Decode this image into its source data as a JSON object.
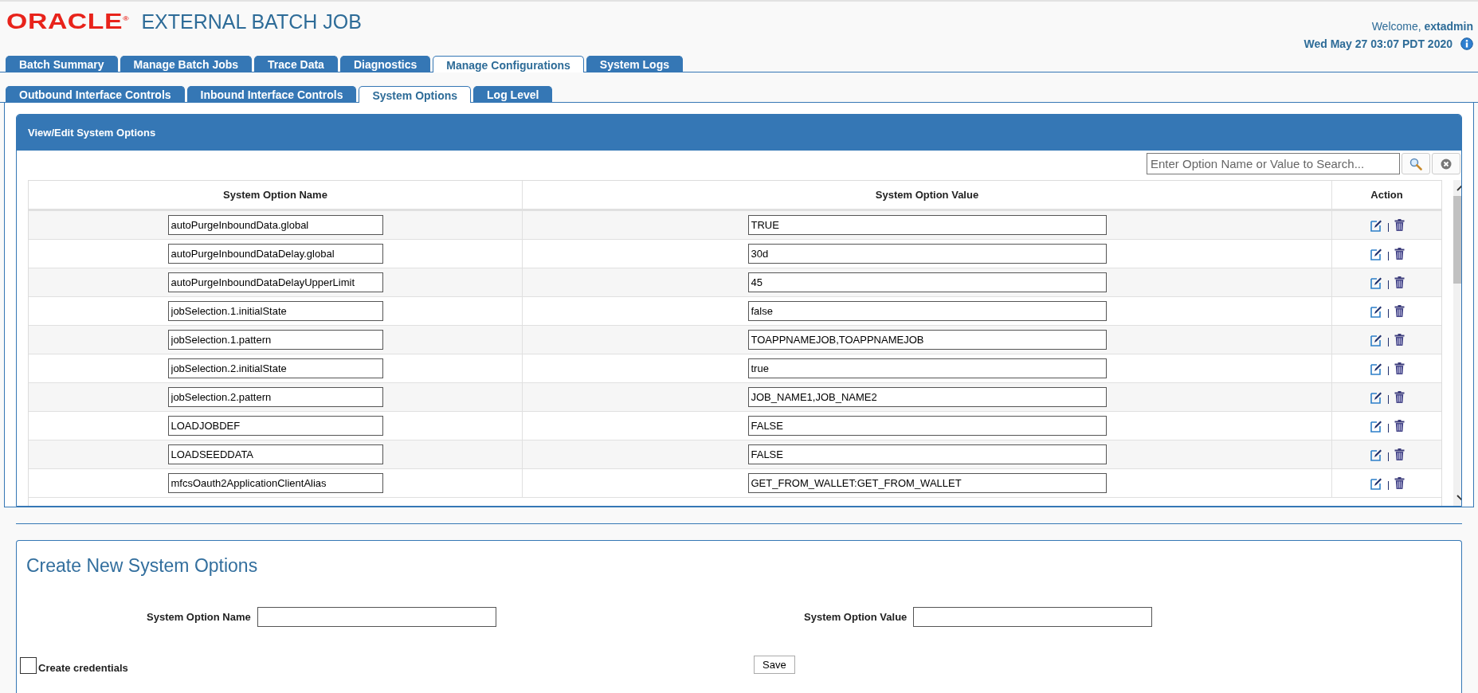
{
  "header": {
    "logo": "ORACLE$^{®}$",
    "title": "EXTERNAL BATCH JOB",
    "welcome": "Welcome, **extadmin**",
    "datetime": "Wed May 27 03:07 PDT 2020"
  },
  "main_tabs": [
    {
      "label": "Batch Summary",
      "selected": false
    },
    {
      "label": "Manage Batch Jobs",
      "selected": false
    },
    {
      "label": "Trace Data",
      "selected": false
    },
    {
      "label": "Diagnostics",
      "selected": false
    },
    {
      "label": "Manage Configurations",
      "selected": true
    },
    {
      "label": "System Logs",
      "selected": false
    }
  ],
  "sub_tabs": [
    {
      "label": "Outbound Interface Controls",
      "selected": false
    },
    {
      "label": "Inbound Interface Controls",
      "selected": false
    },
    {
      "label": "System Options",
      "selected": true
    },
    {
      "label": "Log Level",
      "selected": false
    }
  ],
  "options_panel": {
    "title": "View/Edit System Options",
    "search": {
      "placeholder": "Enter Option Name or Value to Search..."
    },
    "columns": [
      "System Option Name",
      "System Option Value",
      "Action"
    ],
    "rows": [
      {
        "name": "autoPurgeInboundData.global",
        "value": "TRUE"
      },
      {
        "name": "autoPurgeInboundDataDelay.global",
        "value": "30d"
      },
      {
        "name": "autoPurgeInboundDataDelayUpperLimit",
        "value": "45"
      },
      {
        "name": "jobSelection.1.initialState",
        "value": "false"
      },
      {
        "name": "jobSelection.1.pattern",
        "value": "TOAPPNAMEJOB,TOAPPNAMEJOB"
      },
      {
        "name": "jobSelection.2.initialState",
        "value": "true"
      },
      {
        "name": "jobSelection.2.pattern",
        "value": "JOB_NAME1,JOB_NAME2"
      },
      {
        "name": "LOADJOBDEF",
        "value": "FALSE"
      },
      {
        "name": "LOADSEEDDATA",
        "value": "FALSE"
      },
      {
        "name": "mfcsOauth2ApplicationClientAlias",
        "value": "GET_FROM_WALLET:GET_FROM_WALLET"
      }
    ]
  },
  "create_form": {
    "title": "Create New System Options",
    "name_label": "System Option Name",
    "value_label": "System Option Value",
    "credentials": {
      "label": "Create credentials",
      "checked": false
    },
    "save_button": "Save"
  }
}
